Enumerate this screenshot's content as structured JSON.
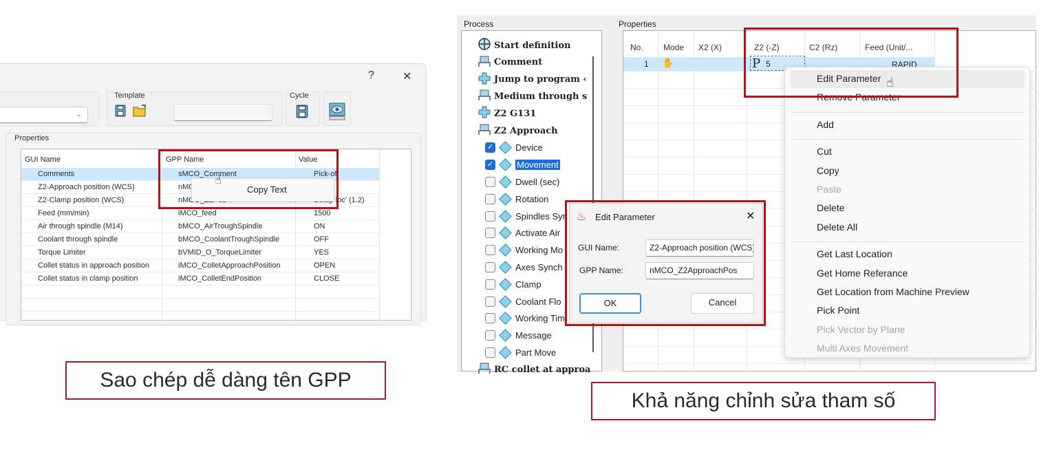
{
  "left_panel": {
    "title_buttons": {
      "help": "?",
      "close": "✕"
    },
    "template_group": {
      "label": "Template",
      "save_icon": "floppy-save-icon",
      "open_icon": "folder-open-icon",
      "name_value": ""
    },
    "cycle_group": {
      "label": "Cycle",
      "save_icon": "floppy-save-icon"
    },
    "preview_icon": "machine-preview-icon",
    "properties_label": "Properties",
    "table": {
      "headers": [
        "GUI Name",
        "GPP Name",
        "Value"
      ],
      "rows": [
        {
          "gui": "Comments",
          "gpp": "sMCO_Comment",
          "value": "Pick-off",
          "selected": true
        },
        {
          "gui": "Z2-Approach position (WCS)",
          "gpp": "nMCO_Z2",
          "value": ""
        },
        {
          "gui": "Z2-Clamp position (WCS)",
          "gpp": "nMCO_Z2Pos",
          "value": "Setup loc' (1.2)"
        },
        {
          "gui": "Feed (mm/min)",
          "gpp": "iMCO_feed",
          "value": "1500"
        },
        {
          "gui": "Air through spindle (M14)",
          "gpp": "bMCO_AirTroughSpindle",
          "value": "ON"
        },
        {
          "gui": "Coolant through spindle",
          "gpp": "bMCO_CoolantTroughSpindle",
          "value": "OFF"
        },
        {
          "gui": "Torque Limiter",
          "gpp": "bVMID_O_TorqueLimiter",
          "value": "YES"
        },
        {
          "gui": "Collet status in approach position",
          "gpp": "iMCO_ColletApproachPosition",
          "value": "OPEN"
        },
        {
          "gui": "Collet status in clamp position",
          "gpp": "iMCO_ColletEndPosition",
          "value": "CLOSE"
        }
      ]
    },
    "context_menu": {
      "items": [
        "Copy Text"
      ]
    },
    "caption": "Sao chép dễ dàng tên GPP"
  },
  "right_panel": {
    "process_label": "Process",
    "properties_label": "Properties",
    "tree": [
      {
        "label": "Start definition",
        "icon": "start-definition-icon",
        "top": true
      },
      {
        "label": "Comment",
        "icon": "block-icon",
        "top": true
      },
      {
        "label": "Jump to program ‹",
        "icon": "plus-cross-icon",
        "top": true
      },
      {
        "label": "Medium through s",
        "icon": "block-icon",
        "top": true
      },
      {
        "label": "Z2 G131",
        "icon": "plus-cross-icon",
        "top": true
      },
      {
        "label": "Z2 Approach",
        "icon": "block-icon",
        "top": true
      },
      {
        "label": "Device",
        "checked": true
      },
      {
        "label": "Movement",
        "checked": true,
        "selected": true
      },
      {
        "label": "Dwell (sec)",
        "checked": false
      },
      {
        "label": "Rotation",
        "checked": false
      },
      {
        "label": "Spindles Syn",
        "checked": false
      },
      {
        "label": "Activate Air",
        "checked": false
      },
      {
        "label": "Working Mo",
        "checked": false
      },
      {
        "label": "Axes Synch",
        "checked": false
      },
      {
        "label": "Clamp",
        "checked": false
      },
      {
        "label": "Coolant Flo",
        "checked": false
      },
      {
        "label": "Working Tim",
        "checked": false
      },
      {
        "label": "Message",
        "checked": false
      },
      {
        "label": "Part Move",
        "checked": false
      },
      {
        "label": "RC collet at approa",
        "icon": "block-icon",
        "top": true
      }
    ],
    "grid": {
      "headers": [
        "No.",
        "Mode",
        "X2 (X)",
        "Z2 (-Z)",
        "C2 (Rz)",
        "Feed (Unit/..."
      ],
      "row": {
        "no": "1",
        "mode_icon": "hand-mode-icon",
        "x2": "",
        "z2_prefix": "P",
        "z2": "5",
        "c2": "",
        "feed": "RAPID"
      }
    },
    "context_menu": {
      "groups": [
        [
          {
            "label": "Edit Parameter",
            "hover": true
          },
          {
            "label": "Remove Parameter"
          }
        ],
        [
          {
            "label": "Add"
          }
        ],
        [
          {
            "label": "Cut"
          },
          {
            "label": "Copy"
          },
          {
            "label": "Paste",
            "disabled": true
          },
          {
            "label": "Delete"
          },
          {
            "label": "Delete All"
          }
        ],
        [
          {
            "label": "Get Last Location"
          },
          {
            "label": "Get Home Referance"
          },
          {
            "label": "Get Location from Machine Preview"
          },
          {
            "label": "Pick Point"
          },
          {
            "label": "Pick Vector by Plane",
            "disabled": true
          },
          {
            "label": "Multi Axes Movement",
            "disabled": true
          }
        ]
      ]
    },
    "edit_dialog": {
      "title": "Edit Parameter",
      "close": "✕",
      "gui_name_label": "GUI Name:",
      "gui_name_value": "Z2-Approach position (WCS)",
      "gpp_name_label": "GPP Name:",
      "gpp_name_value": "nMCO_Z2ApproachPos",
      "ok": "OK",
      "cancel": "Cancel"
    },
    "caption": "Khả năng chỉnh sửa tham số"
  },
  "colors": {
    "highlight_red": "#b0151b",
    "selection_blue": "#cde8fb",
    "tree_selected": "#1a6fd6"
  }
}
